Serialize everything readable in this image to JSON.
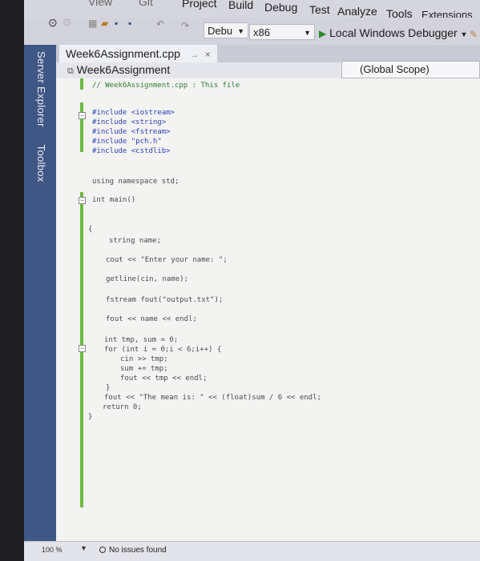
{
  "menu": {
    "items": [
      "View",
      "Git",
      "Project",
      "Build",
      "Debug",
      "Test",
      "Analyze",
      "Tools",
      "Extensions"
    ]
  },
  "toolbar": {
    "config": "Debu",
    "platform": "x86",
    "debugger": "Local Windows Debugger"
  },
  "side_panels": [
    "Server Explorer",
    "Toolbox"
  ],
  "tab": {
    "file": "Week6Assignment.cpp",
    "pin": "→",
    "close": "×"
  },
  "navbar": {
    "project": "Week6Assignment",
    "scope": "(Global Scope)"
  },
  "code": {
    "comment": "// Week6Assignment.cpp : This file",
    "inc1": "#include <iostream>",
    "inc2": "#include <string>",
    "inc3": "#include <fstream>",
    "inc4": "#include \"pch.h\"",
    "inc5": "#include <cstdlib>",
    "using": "using namespace std;",
    "main": "int main()",
    "open_brace": "{",
    "l1": "string name;",
    "l2": "cout << \"Enter your name: \";",
    "l3": "getline(cin, name);",
    "l4": "fstream fout(\"output.txt\");",
    "l5": "fout << name << endl;",
    "l6": "int tmp, sum = 0;",
    "l7": "for (int i = 0;i < 6;i++) {",
    "l8": "cin >> tmp;",
    "l9": "sum += tmp;",
    "l10": "fout << tmp << endl;",
    "l11": "}",
    "l12": "fout << \"The mean is: \" << (float)sum / 6 << endl;",
    "l13": "return 0;",
    "close_brace": "}"
  },
  "status": {
    "zoom": "100 %",
    "issues": "No issues found"
  },
  "colors": {
    "accent_blue": "#3f5785",
    "change_bar": "#6dbb3f",
    "keyword": "#2d3fb8",
    "string": "#b0402c"
  }
}
